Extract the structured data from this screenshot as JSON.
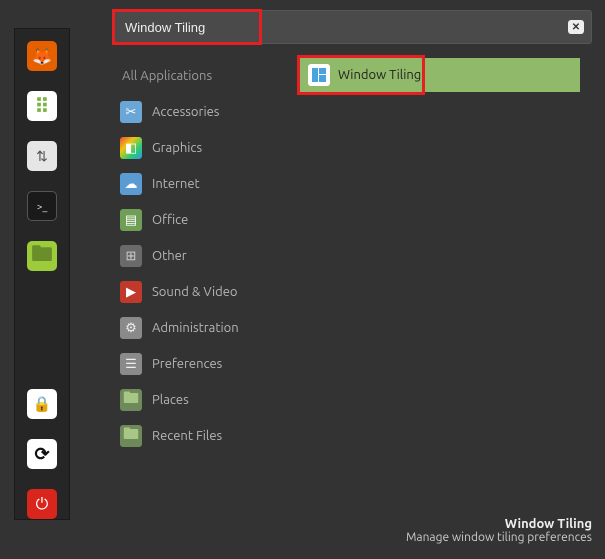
{
  "search": {
    "value": "Window Tiling",
    "clear_glyph": "✕"
  },
  "categories": {
    "header": "All Applications",
    "items": [
      {
        "label": "Accessories",
        "icon": "scissors-icon",
        "bg": "#6aa6d6",
        "fg": "#fff",
        "glyph": "✂"
      },
      {
        "label": "Graphics",
        "icon": "graphics-icon",
        "bg": "linear",
        "fg": "#fff",
        "glyph": "◧"
      },
      {
        "label": "Internet",
        "icon": "cloud-icon",
        "bg": "#5a9bd4",
        "fg": "#fff",
        "glyph": "☁"
      },
      {
        "label": "Office",
        "icon": "office-icon",
        "bg": "#6f9e57",
        "fg": "#fff",
        "glyph": "▤"
      },
      {
        "label": "Other",
        "icon": "grid-icon",
        "bg": "#6a6a6a",
        "fg": "#ccc",
        "glyph": "⊞"
      },
      {
        "label": "Sound & Video",
        "icon": "play-icon",
        "bg": "#c0392b",
        "fg": "#fff",
        "glyph": "▶"
      },
      {
        "label": "Administration",
        "icon": "admin-icon",
        "bg": "#8a8a8a",
        "fg": "#eee",
        "glyph": "⚙"
      },
      {
        "label": "Preferences",
        "icon": "prefs-icon",
        "bg": "#8a8a8a",
        "fg": "#eee",
        "glyph": "☰"
      },
      {
        "label": "Places",
        "icon": "folder-icon",
        "bg": "#6f8a5a",
        "fg": "#fff",
        "glyph": "🖿"
      },
      {
        "label": "Recent Files",
        "icon": "recent-icon",
        "bg": "#6f8a5a",
        "fg": "#fff",
        "glyph": "🖿"
      }
    ]
  },
  "results": [
    {
      "label": "Window Tiling",
      "icon": "tiling-icon"
    }
  ],
  "footer": {
    "title": "Window Tiling",
    "desc": "Manage window tiling preferences"
  },
  "sidebar": [
    {
      "name": "firefox-icon",
      "bg": "#e66000",
      "fg": "#fff",
      "glyph": "🦊"
    },
    {
      "name": "apps-icon",
      "bg": "#ffffff",
      "fg": "#7cb342",
      "glyph": "⠿"
    },
    {
      "name": "settings-icon",
      "bg": "#e6e6e6",
      "fg": "#555",
      "glyph": "⇅"
    },
    {
      "name": "terminal-icon",
      "bg": "#1a1a1a",
      "fg": "#ddd",
      "glyph": ">_"
    },
    {
      "name": "files-icon",
      "bg": "#9ccc3c",
      "fg": "#6a8f2a",
      "glyph": "🖿"
    },
    {
      "name": "lock-icon",
      "bg": "#ffffff",
      "fg": "#111",
      "glyph": "🔒"
    },
    {
      "name": "restart-icon",
      "bg": "#ffffff",
      "fg": "#111",
      "glyph": "⟳"
    },
    {
      "name": "power-icon",
      "bg": "#d8261c",
      "fg": "#fff",
      "glyph": "⏻"
    }
  ]
}
